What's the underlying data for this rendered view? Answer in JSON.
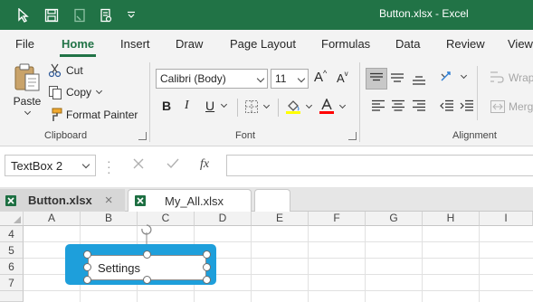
{
  "window": {
    "title": "Button.xlsx  -  Excel"
  },
  "ribbon_tabs": [
    "File",
    "Home",
    "Insert",
    "Draw",
    "Page Layout",
    "Formulas",
    "Data",
    "Review",
    "View"
  ],
  "clipboard": {
    "paste": "Paste",
    "cut": "Cut",
    "copy": "Copy",
    "format_painter": "Format Painter",
    "label": "Clipboard"
  },
  "font": {
    "name": "Calibri (Body)",
    "size": "11",
    "label": "Font",
    "bold": "B",
    "italic": "I",
    "underline": "U",
    "fill_color": "#ffff00",
    "font_color": "#ff0000",
    "grow": "A",
    "shrink": "A"
  },
  "alignment": {
    "label": "Alignment",
    "wrap": "Wrap",
    "merge": "Merg"
  },
  "formula_bar": {
    "name_box": "TextBox 2",
    "fx": "fx",
    "value": ""
  },
  "workbooks": [
    {
      "name": "Button.xlsx",
      "close": "×"
    },
    {
      "name": "My_All.xlsx"
    }
  ],
  "columns": [
    "A",
    "B",
    "C",
    "D",
    "E",
    "F",
    "G",
    "H",
    "I"
  ],
  "rows": [
    "4",
    "5",
    "6",
    "7"
  ],
  "shape": {
    "text": "Settings",
    "fill": "#1e9fdb"
  },
  "colors": {
    "accent": "#217346"
  }
}
